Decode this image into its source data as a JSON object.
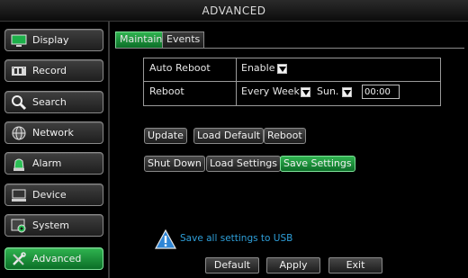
{
  "window": {
    "title": "ADVANCED"
  },
  "sidebar": {
    "items": [
      {
        "label": "Display",
        "icon": "monitor-icon"
      },
      {
        "label": "Record",
        "icon": "film-icon"
      },
      {
        "label": "Search",
        "icon": "search-icon"
      },
      {
        "label": "Network",
        "icon": "globe-icon"
      },
      {
        "label": "Alarm",
        "icon": "siren-icon"
      },
      {
        "label": "Device",
        "icon": "device-icon"
      },
      {
        "label": "System",
        "icon": "system-gear-icon"
      },
      {
        "label": "Advanced",
        "icon": "tools-icon",
        "active": true
      }
    ]
  },
  "tabs": [
    {
      "label": "Maintain",
      "active": true
    },
    {
      "label": "Events"
    }
  ],
  "maintain": {
    "auto_reboot": {
      "label": "Auto Reboot",
      "value": "Enable"
    },
    "reboot": {
      "label": "Reboot",
      "frequency": "Every Week",
      "day": "Sun.",
      "time": "00:00"
    }
  },
  "actions": {
    "update": "Update",
    "load_default": "Load Default",
    "reboot": "Reboot",
    "shut_down": "Shut Down",
    "load_settings": "Load Settings",
    "save_settings": "Save Settings"
  },
  "notice": {
    "message": "Save all settings to USB",
    "icon": "warning-triangle-icon"
  },
  "footer": {
    "default": "Default",
    "apply": "Apply",
    "exit": "Exit"
  },
  "colors": {
    "accent": "#1a9a3c",
    "info": "#2e9fd9",
    "background": "#000000"
  }
}
